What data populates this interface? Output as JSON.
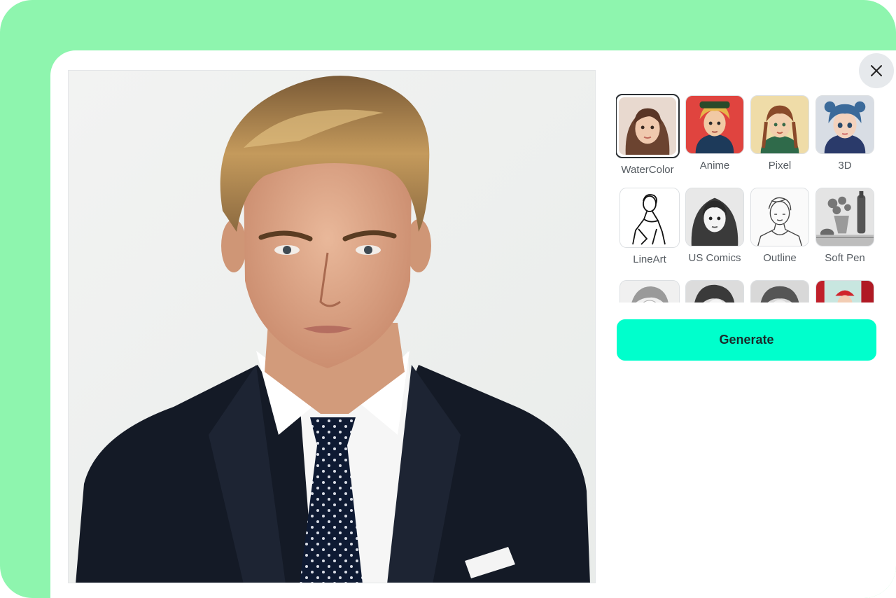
{
  "styles": [
    {
      "label": "WaterColor",
      "selected": true
    },
    {
      "label": "Anime"
    },
    {
      "label": "Pixel"
    },
    {
      "label": "3D"
    },
    {
      "label": "LineArt"
    },
    {
      "label": "US Comics"
    },
    {
      "label": "Outline"
    },
    {
      "label": "Soft Pen"
    },
    {
      "label": ""
    },
    {
      "label": ""
    },
    {
      "label": ""
    },
    {
      "label": ""
    }
  ],
  "actions": {
    "generate_label": "Generate"
  },
  "icons": {
    "close": "close-icon"
  },
  "colors": {
    "backdrop": "#8ef5ae",
    "generate_button": "#00ffcc",
    "selected_border": "#2b2f33"
  }
}
